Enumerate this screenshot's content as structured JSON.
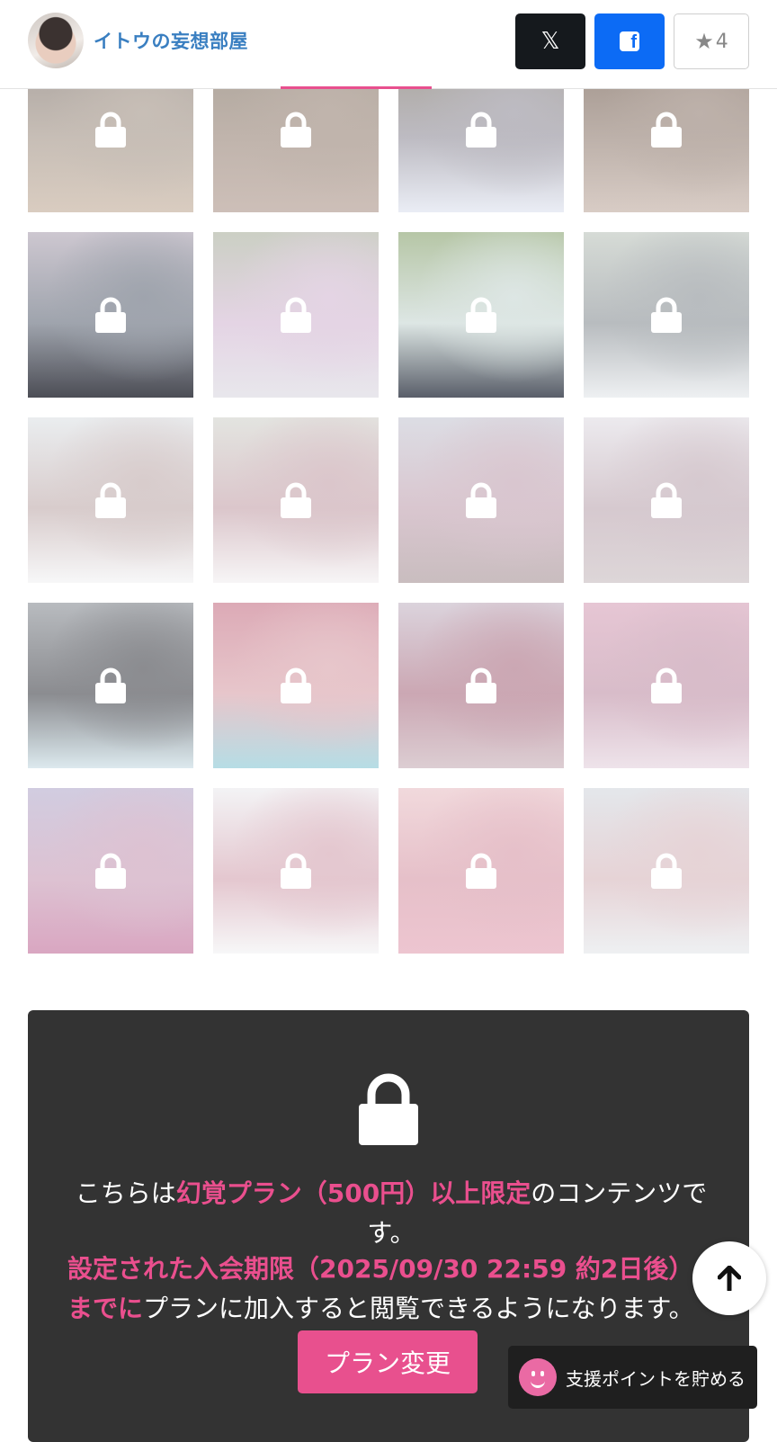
{
  "header": {
    "creator_name": "イトウの妄想部屋",
    "x_button_label": "𝕏",
    "facebook_button_label": "f",
    "favorite_count": "4"
  },
  "gallery": {
    "tiles": [
      {
        "colors": [
          "#a9a29e",
          "#c7beb6",
          "#d9ccc0"
        ]
      },
      {
        "colors": [
          "#aca49a",
          "#c0b4ac",
          "#cdbfb8"
        ]
      },
      {
        "colors": [
          "#a8a398",
          "#bdbbc2",
          "#eaedf5"
        ]
      },
      {
        "colors": [
          "#9e9188",
          "#bdb1aa",
          "#d8ccc5"
        ]
      },
      {
        "colors": [
          "#cdc7d0",
          "#9fa4ad",
          "#4c4d55"
        ]
      },
      {
        "colors": [
          "#cbcfc4",
          "#e4d4e4",
          "#e8e7ec"
        ]
      },
      {
        "colors": [
          "#b6c6a6",
          "#dde6e4",
          "#595e69"
        ]
      },
      {
        "colors": [
          "#d6dbd6",
          "#b8bcbf",
          "#eef0f2"
        ]
      },
      {
        "colors": [
          "#eaedef",
          "#d8cccc",
          "#f7f7f8"
        ]
      },
      {
        "colors": [
          "#e3e4e0",
          "#dbc6cb",
          "#f7f5f6"
        ]
      },
      {
        "colors": [
          "#dcdde4",
          "#d9c6cf",
          "#c9bdbf"
        ]
      },
      {
        "colors": [
          "#eceaee",
          "#d6c9cf",
          "#ddd6d8"
        ]
      },
      {
        "colors": [
          "#b8bbbf",
          "#8b8c90",
          "#dce9ee"
        ]
      },
      {
        "colors": [
          "#dcaab6",
          "#e7c6cb",
          "#b6dde5"
        ]
      },
      {
        "colors": [
          "#dbd3dc",
          "#cba7b3",
          "#dccdd2"
        ]
      },
      {
        "colors": [
          "#e6c6d4",
          "#d8bcc9",
          "#eee3ea"
        ]
      },
      {
        "colors": [
          "#d1cce0",
          "#ddc2d2",
          "#d9a6c1"
        ]
      },
      {
        "colors": [
          "#f3f3f5",
          "#e4c7cf",
          "#f7f7f8"
        ]
      },
      {
        "colors": [
          "#f1d9dc",
          "#e6c0c9",
          "#edc5d0"
        ]
      },
      {
        "colors": [
          "#e4e7eb",
          "#e6d3d6",
          "#eef0f2"
        ]
      }
    ]
  },
  "locked_panel": {
    "prefix": "こちらは",
    "plan_name": "幻覚プラン（500円）以上限定",
    "suffix": "のコンテンツです。",
    "deadline": "設定された入会期限（2025/09/30 22:59 約2日後）までに",
    "deadline_suffix": "プランに加入すると閲覧できるようになります。",
    "plan_change_button": "プラン変更"
  },
  "floating": {
    "scroll_top_label": "↑",
    "support_points_label": "支援ポイントを貯める"
  },
  "colors": {
    "accent_pink": "#e8508e",
    "creator_blue": "#3a7fc1",
    "panel_bg": "#333333",
    "facebook_blue": "#0c6bf5"
  }
}
